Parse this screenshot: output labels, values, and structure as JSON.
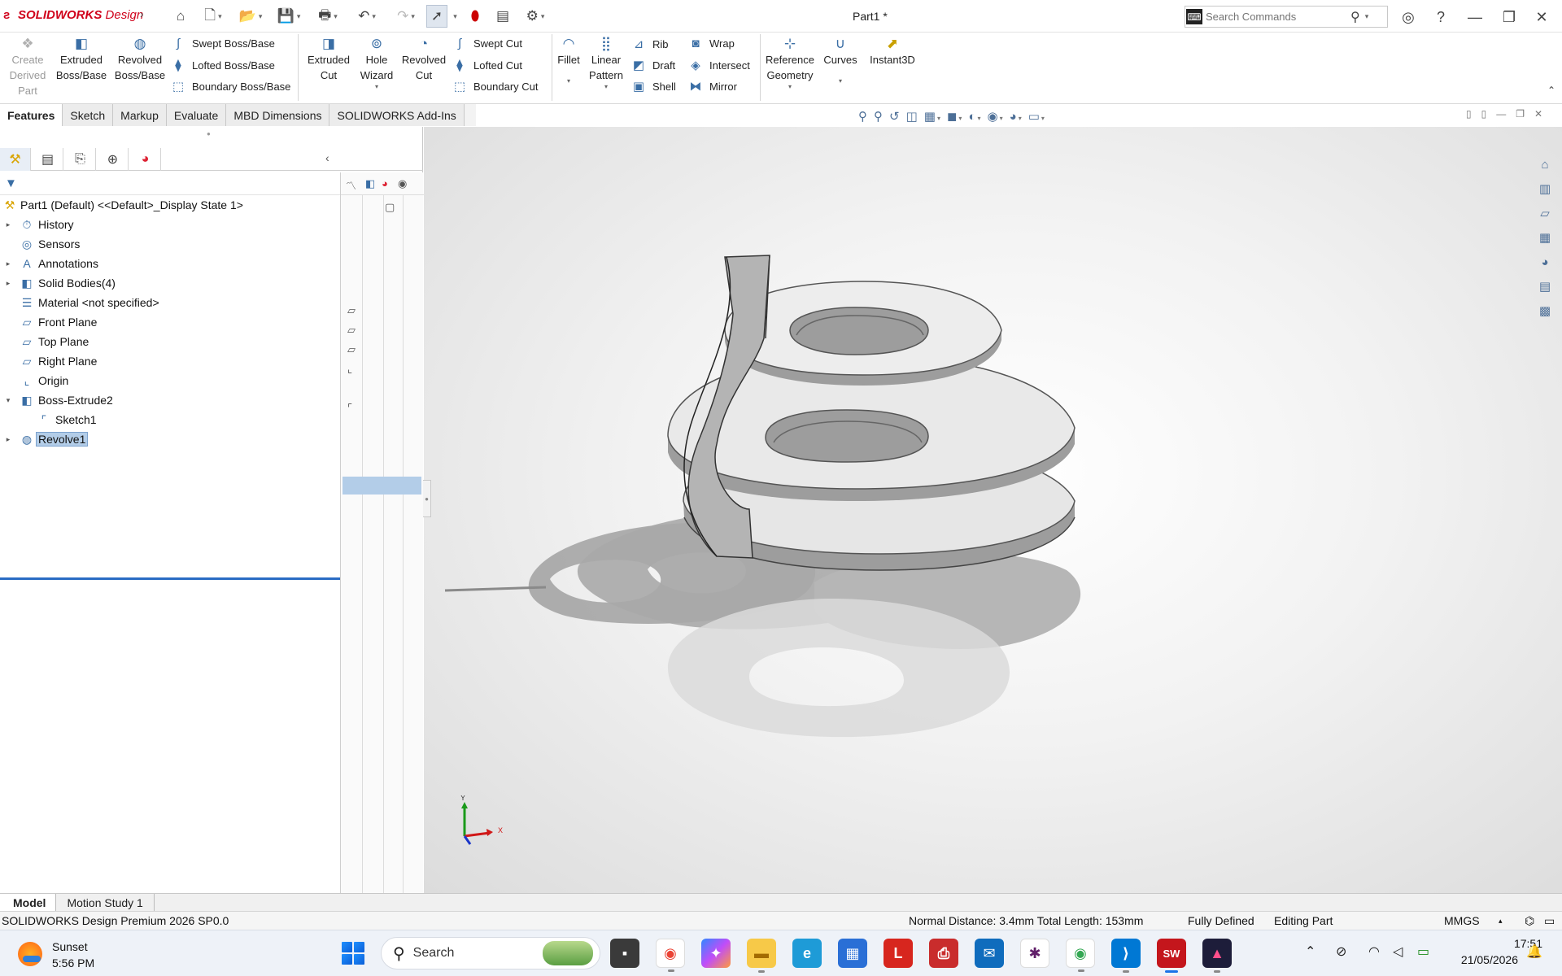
{
  "app": {
    "logo_brand": "SOLIDWORKS",
    "logo_product": "Design",
    "document_title": "Part1 *",
    "search_placeholder": "Search Commands"
  },
  "ribbon": {
    "create_derived_part": "Create Derived Part",
    "extruded_boss": "Extruded Boss/Base",
    "revolved_boss": "Revolved Boss/Base",
    "swept_boss": "Swept Boss/Base",
    "lofted_boss": "Lofted Boss/Base",
    "boundary_boss": "Boundary Boss/Base",
    "extruded_cut": "Extruded Cut",
    "hole_wizard": "Hole Wizard",
    "revolved_cut": "Revolved Cut",
    "swept_cut": "Swept Cut",
    "lofted_cut": "Lofted Cut",
    "boundary_cut": "Boundary Cut",
    "fillet": "Fillet",
    "linear_pattern": "Linear Pattern",
    "rib": "Rib",
    "draft": "Draft",
    "shell": "Shell",
    "wrap": "Wrap",
    "intersect": "Intersect",
    "mirror": "Mirror",
    "reference_geometry": "Reference Geometry",
    "curves": "Curves",
    "instant3d": "Instant3D"
  },
  "tabs": [
    "Features",
    "Sketch",
    "Markup",
    "Evaluate",
    "MBD Dimensions",
    "SOLIDWORKS Add-Ins"
  ],
  "feature_tree": {
    "root": "Part1 (Default) <<Default>_Display State 1>",
    "items": [
      {
        "label": "History",
        "icon": "history-icon",
        "expandable": true,
        "indent": 0
      },
      {
        "label": "Sensors",
        "icon": "sensors-icon",
        "expandable": false,
        "indent": 0
      },
      {
        "label": "Annotations",
        "icon": "annotations-icon",
        "expandable": true,
        "indent": 0
      },
      {
        "label": "Solid Bodies(4)",
        "icon": "solid-bodies-icon",
        "expandable": true,
        "indent": 0
      },
      {
        "label": "Material <not specified>",
        "icon": "material-icon",
        "expandable": false,
        "indent": 0
      },
      {
        "label": "Front Plane",
        "icon": "plane-icon",
        "expandable": false,
        "indent": 0
      },
      {
        "label": "Top Plane",
        "icon": "plane-icon",
        "expandable": false,
        "indent": 0
      },
      {
        "label": "Right Plane",
        "icon": "plane-icon",
        "expandable": false,
        "indent": 0
      },
      {
        "label": "Origin",
        "icon": "origin-icon",
        "expandable": false,
        "indent": 0
      },
      {
        "label": "Boss-Extrude2",
        "icon": "boss-extrude-icon",
        "expandable": true,
        "expanded": true,
        "indent": 0
      },
      {
        "label": "Sketch1",
        "icon": "sketch-icon",
        "expandable": false,
        "indent": 1
      },
      {
        "label": "Revolve1",
        "icon": "revolve-icon",
        "expandable": true,
        "indent": 0,
        "selected": true
      }
    ]
  },
  "bottom_tabs": [
    "Model",
    "Motion Study 1"
  ],
  "status": {
    "product": "SOLIDWORKS Design Premium 2026 SP0.0",
    "measure": "Normal Distance: 3.4mm Total Length: 153mm",
    "sketch_state": "Fully Defined",
    "mode": "Editing Part",
    "units": "MMGS"
  },
  "triad": {
    "x": "X",
    "y": "Y"
  },
  "taskbar": {
    "weather_label": "Sunset",
    "weather_time": "5:56 PM",
    "search_label": "Search",
    "time": "17:51",
    "date": "21/05/2026"
  },
  "colors": {
    "accent": "#2a6cc4",
    "selection": "#b3cde8",
    "brand_red": "#d0021b",
    "model_gray": "#c8c8c8"
  }
}
